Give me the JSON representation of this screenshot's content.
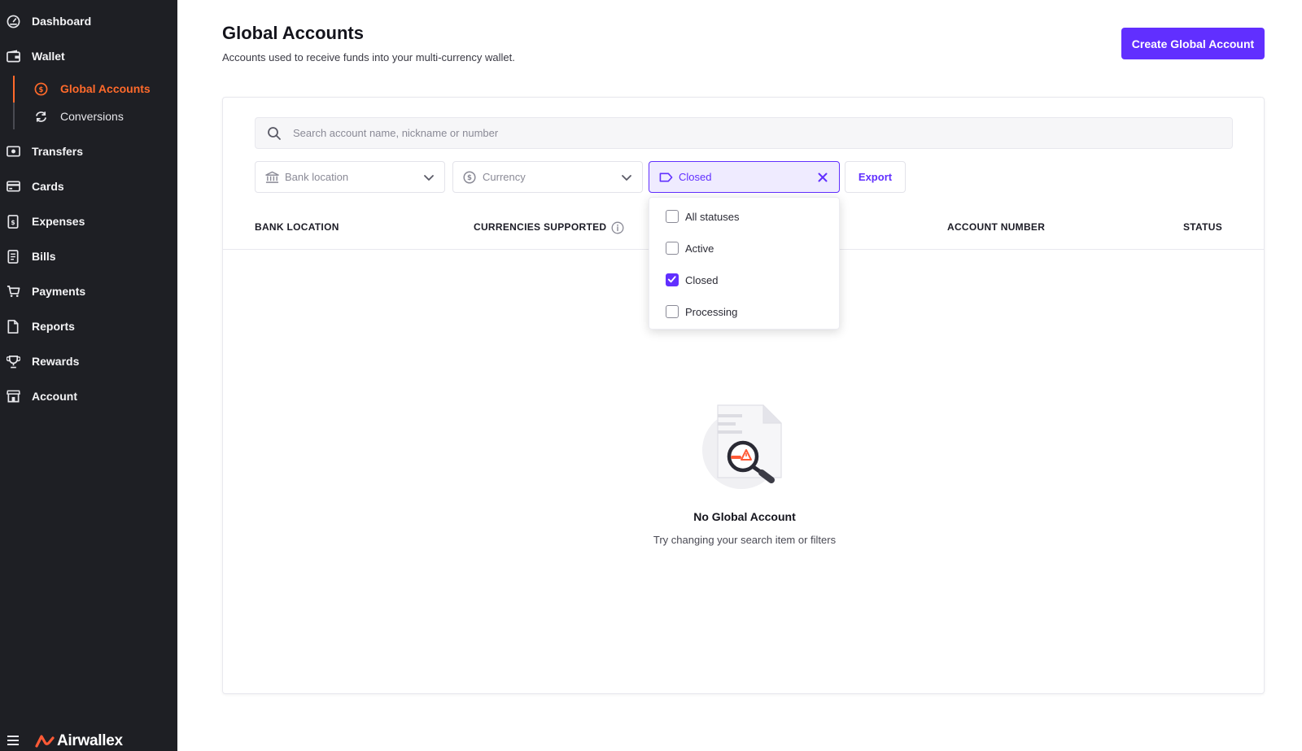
{
  "sidebar": {
    "items": [
      {
        "label": "Dashboard",
        "icon": "dashboard-icon"
      },
      {
        "label": "Wallet",
        "icon": "wallet-icon"
      },
      {
        "label": "Transfers",
        "icon": "transfers-icon"
      },
      {
        "label": "Cards",
        "icon": "cards-icon"
      },
      {
        "label": "Expenses",
        "icon": "expenses-icon"
      },
      {
        "label": "Bills",
        "icon": "bills-icon"
      },
      {
        "label": "Payments",
        "icon": "cart-icon"
      },
      {
        "label": "Reports",
        "icon": "report-icon"
      },
      {
        "label": "Rewards",
        "icon": "trophy-icon"
      },
      {
        "label": "Account",
        "icon": "store-icon"
      }
    ],
    "wallet_subitems": [
      {
        "label": "Global Accounts",
        "icon": "dollar-circle-icon",
        "active": true
      },
      {
        "label": "Conversions",
        "icon": "refresh-icon",
        "active": false
      }
    ],
    "brand": "Airwallex"
  },
  "header": {
    "title": "Global Accounts",
    "subtitle": "Accounts used to receive funds into your multi-currency wallet.",
    "create_button": "Create Global Account"
  },
  "search": {
    "placeholder": "Search account name, nickname or number",
    "value": ""
  },
  "filters": {
    "bank_location": "Bank location",
    "currency": "Currency",
    "status": "Closed",
    "export": "Export"
  },
  "table": {
    "columns": [
      "BANK LOCATION",
      "CURRENCIES SUPPORTED",
      "ACCOUNT NUMBER",
      "STATUS"
    ]
  },
  "status_dropdown": {
    "options": [
      {
        "label": "All statuses",
        "checked": false
      },
      {
        "label": "Active",
        "checked": false
      },
      {
        "label": "Closed",
        "checked": true
      },
      {
        "label": "Processing",
        "checked": false
      }
    ]
  },
  "empty_state": {
    "title": "No Global Account",
    "subtitle": "Try changing your search item or filters"
  },
  "colors": {
    "sidebar_bg": "#1e1f24",
    "accent": "#612fff",
    "active_nav": "#ff6a2b"
  }
}
